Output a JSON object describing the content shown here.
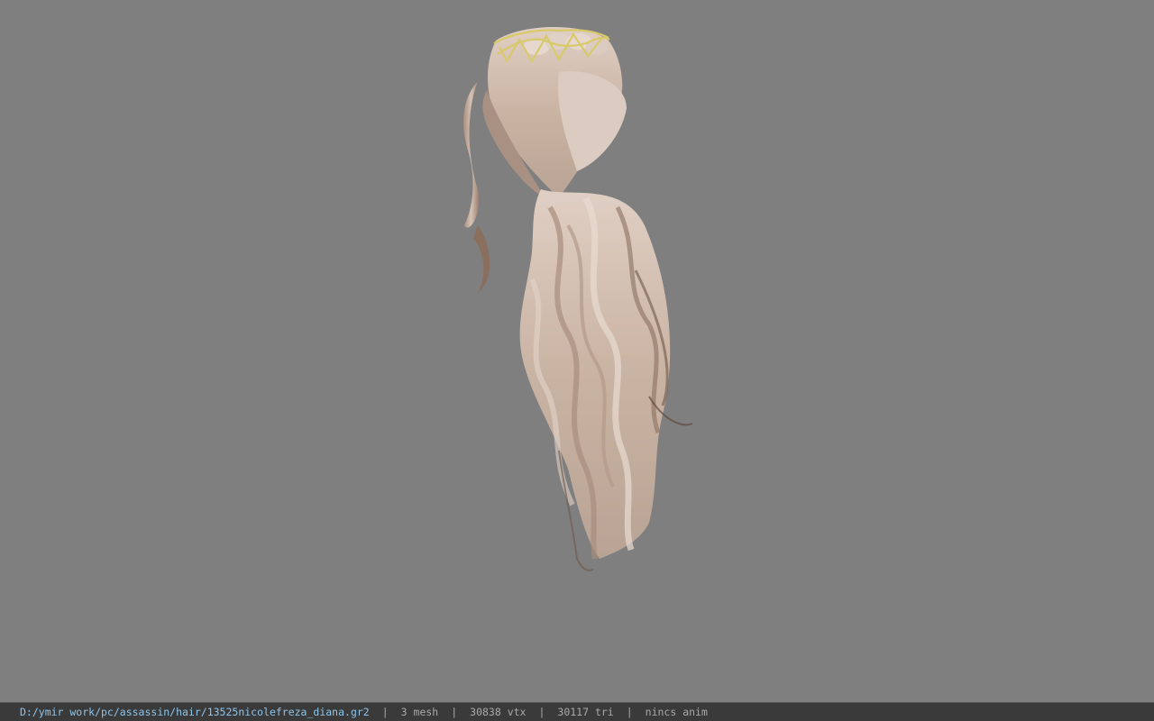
{
  "viewport": {
    "background_color": "#7f7f7f",
    "model_hair_color": "#c9b3a3",
    "model_hair_shadow_color": "#8a6f5f",
    "tiara_color": "#d8c96a"
  },
  "statusbar": {
    "file_path": "D:/ymir work/pc/assassin/hair/13525nicolefreza_diana.gr2",
    "separator": "|",
    "mesh_count": "3 mesh",
    "vertex_count": "30838 vtx",
    "triangle_count": "30117 tri",
    "anim_status": "nincs anim",
    "path_color": "#8ec4ea",
    "text_color": "#a9a9a9"
  }
}
